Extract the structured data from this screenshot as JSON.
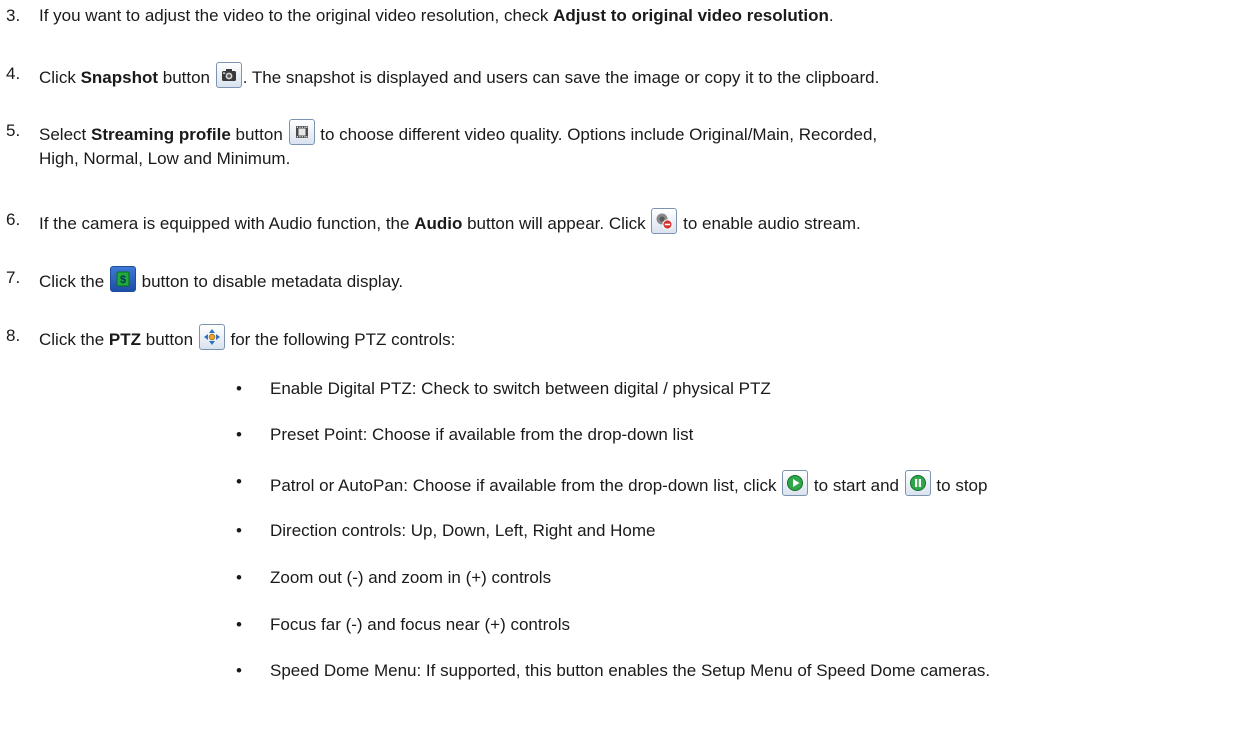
{
  "steps": [
    {
      "num": "3.",
      "t1": "If you want to adjust the video to the original video resolution, check ",
      "b1": "Adjust to original video resolution",
      "t2": "."
    },
    {
      "num": "4.",
      "t1": "Click ",
      "b1": "Snapshot",
      "t2": " button ",
      "icon": "camera-icon",
      "t3": ". The snapshot is displayed and users can save the image or copy it to the clipboard."
    },
    {
      "num": "5.",
      "t1": "Select ",
      "b1": "Streaming profile",
      "t2": " button ",
      "icon": "film-strip-icon",
      "t3": " to choose different video quality.  Options include Original/Main, Recorded,",
      "t4": "High, Normal, Low and Minimum."
    },
    {
      "num": "6.",
      "t1": "If the camera is equipped with Audio function, the ",
      "b1": "Audio",
      "t2": " button will appear. Click ",
      "icon": "audio-muted-icon",
      "t3": " to enable audio stream."
    },
    {
      "num": "7.",
      "t1": "Click the ",
      "icon": "metadata-icon",
      "t2": " button to disable metadata display."
    },
    {
      "num": "8.",
      "t1": "Click the ",
      "b1": "PTZ",
      "t2": " button ",
      "icon": "ptz-direction-icon",
      "t3": " for the following PTZ controls:"
    }
  ],
  "bullets": [
    {
      "symbol": "•",
      "text": "Enable Digital PTZ: Check to switch between digital / physical PTZ"
    },
    {
      "symbol": "•",
      "text": "Preset Point: Choose if available from the drop-down list"
    },
    {
      "symbol": "•",
      "text_a": "Patrol or AutoPan: Choose if available from the drop-down list, click ",
      "icon_a": "play-icon",
      "text_b": " to start and ",
      "icon_b": "pause-icon",
      "text_c": " to stop"
    },
    {
      "symbol": "•",
      "text": "Direction controls: Up, Down, Left, Right and Home"
    },
    {
      "symbol": "•",
      "text": "Zoom out (-) and zoom in (+) controls"
    },
    {
      "symbol": "•",
      "text": "Focus far (-) and focus near (+) controls"
    },
    {
      "symbol": "•",
      "text": "Speed Dome Menu: If supported, this button enables the Setup Menu of Speed Dome cameras."
    }
  ]
}
